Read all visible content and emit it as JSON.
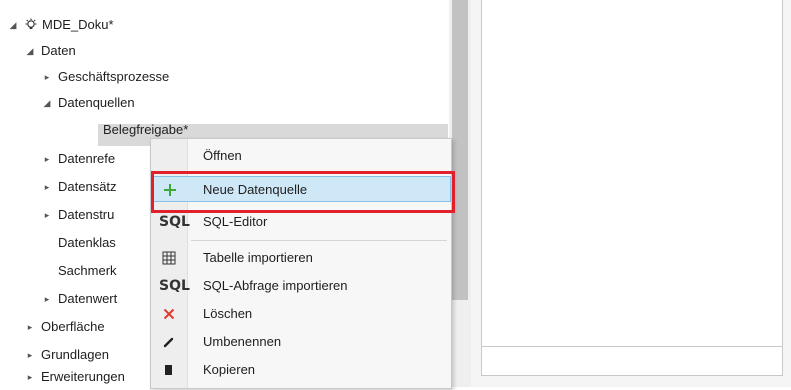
{
  "tree": {
    "root": {
      "label": "MDE_Doku*",
      "toggle": "◢",
      "icon": "bulb-gear-icon"
    },
    "items": [
      {
        "label": "Daten",
        "toggle": "◢"
      },
      {
        "label": "Geschäftsprozesse",
        "toggle": "▸"
      },
      {
        "label": "Datenquellen",
        "toggle": "◢"
      },
      {
        "label": "Belegfreigabe*"
      },
      {
        "label": "Datenrefe",
        "toggle": "▸"
      },
      {
        "label": "Datensätz",
        "toggle": "▸"
      },
      {
        "label": "Datenstru",
        "toggle": "▸"
      },
      {
        "label": "Datenklas"
      },
      {
        "label": "Sachmerk"
      },
      {
        "label": "Datenwert",
        "toggle": "▸"
      },
      {
        "label": "Oberfläche",
        "toggle": "▸"
      },
      {
        "label": "Grundlagen",
        "toggle": "▸"
      },
      {
        "label": "Erweiterungen",
        "toggle": "▸"
      }
    ]
  },
  "context_menu": {
    "items": [
      {
        "label": "Öffnen",
        "icon": ""
      },
      {
        "label": "Neue Datenquelle",
        "icon": "+",
        "icon_name": "plus-icon",
        "highlighted": true
      },
      {
        "label": "SQL-Editor",
        "icon": "SQL",
        "icon_name": "sql-icon"
      },
      {
        "label": "Tabelle importieren",
        "icon": "▦",
        "icon_name": "table-import-icon"
      },
      {
        "label": "SQL-Abfrage importieren",
        "icon": "SQL",
        "icon_name": "sql-import-icon"
      },
      {
        "label": "Löschen",
        "icon": "✕",
        "icon_name": "delete-icon"
      },
      {
        "label": "Umbenennen",
        "icon": "✎",
        "icon_name": "rename-icon"
      },
      {
        "label": "Kopieren",
        "icon": "▮",
        "icon_name": "copy-icon"
      }
    ]
  },
  "colors": {
    "highlight_bg": "#cfe8f7",
    "highlight_border": "#86c1e6",
    "callout": "#e0202a",
    "plus": "#3aa935",
    "delete": "#e03c31"
  }
}
